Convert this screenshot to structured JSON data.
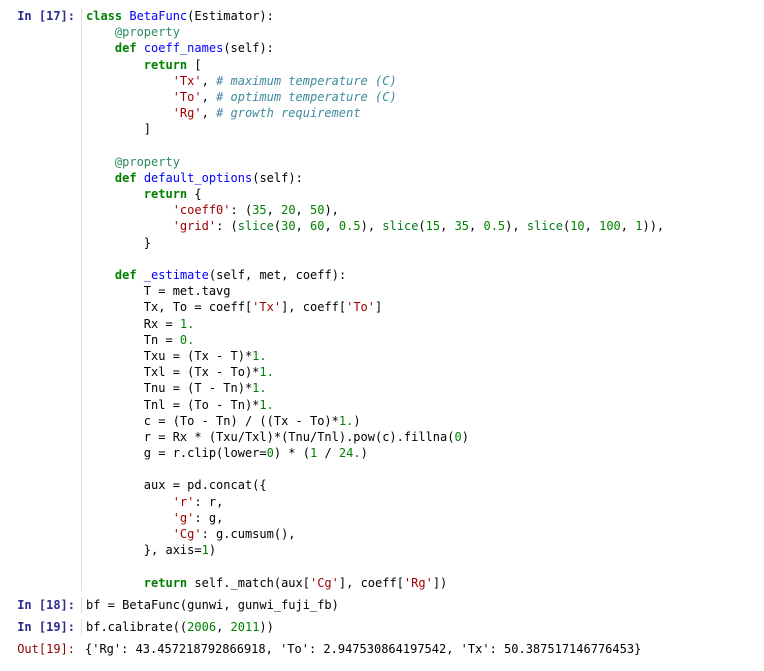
{
  "cells": {
    "cell17": {
      "prompt": "In [17]:",
      "kw_class": "class",
      "class_name": "BetaFunc",
      "estimator": "Estimator",
      "decorator1": "@property",
      "kw_def1": "def",
      "fn_coeff_names": "coeff_names",
      "self1": "self",
      "kw_return1": "return",
      "str_Tx": "'Tx'",
      "com_Tx": "# maximum temperature (C)",
      "str_To": "'To'",
      "com_To": "# optimum temperature (C)",
      "str_Rg": "'Rg'",
      "com_Rg": "# growth requirement",
      "decorator2": "@property",
      "kw_def2": "def",
      "fn_default_options": "default_options",
      "self2": "self",
      "kw_return2": "return",
      "str_coeff0": "'coeff0'",
      "num35": "35",
      "num20": "20",
      "num50": "50",
      "str_grid": "'grid'",
      "slice1": "slice",
      "num30": "30",
      "num60": "60",
      "num05a": "0.5",
      "slice2": "slice",
      "num15": "15",
      "num35b": "35",
      "num05b": "0.5",
      "slice3": "slice",
      "num10": "10",
      "num100": "100",
      "num1a": "1",
      "kw_def3": "def",
      "fn_estimate": "_estimate",
      "self3": "self",
      "met": "met",
      "coeff": "coeff",
      "line_T": "T = met.tavg",
      "coeff_Tx": "'Tx'",
      "coeff_To": "'To'",
      "num1b": "1.",
      "num0": "0.",
      "num1c": "1.",
      "num1d": "1.",
      "num1e": "1.",
      "num1f": "1.",
      "num1g": "1.",
      "num0b": "0",
      "num0c": "0",
      "num1h": "1",
      "num24": "24.",
      "str_r": "'r'",
      "str_g": "'g'",
      "str_Cg": "'Cg'",
      "num1i": "1",
      "kw_return3": "return",
      "aux_Cg": "'Cg'",
      "coeff_Rg": "'Rg'"
    },
    "cell18": {
      "prompt": "In [18]:",
      "line": "bf = BetaFunc(gunwi, gunwi_fuji_fb)"
    },
    "cell19": {
      "prompt": "In [19]:",
      "prefix": "bf.calibrate((",
      "num2006": "2006",
      "num2011": "2011",
      "suffix": "))"
    },
    "out19": {
      "prompt": "Out[19]:",
      "text": "{'Rg': 43.457218792866918, 'To': 2.947530864197542, 'Tx': 50.387517146776453}"
    }
  }
}
